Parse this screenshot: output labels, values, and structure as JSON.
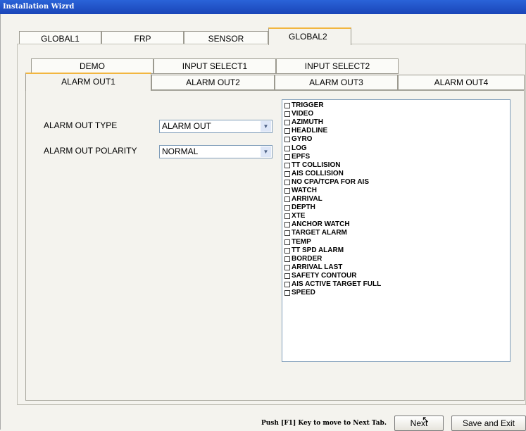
{
  "window": {
    "title": "Installation Wizrd"
  },
  "top_tabs": [
    {
      "label": "GLOBAL1",
      "active": false
    },
    {
      "label": "FRP",
      "active": false
    },
    {
      "label": "SENSOR",
      "active": false
    },
    {
      "label": "GLOBAL2",
      "active": true
    }
  ],
  "sub_tabs_row1": [
    {
      "label": "DEMO"
    },
    {
      "label": "INPUT SELECT1"
    },
    {
      "label": "INPUT SELECT2"
    }
  ],
  "sub_tabs_row2": [
    {
      "label": "ALARM OUT1",
      "active": true
    },
    {
      "label": "ALARM OUT2",
      "active": false
    },
    {
      "label": "ALARM OUT3",
      "active": false
    },
    {
      "label": "ALARM OUT4",
      "active": false
    }
  ],
  "form": {
    "type_label": "ALARM OUT TYPE",
    "type_value": "ALARM OUT",
    "polarity_label": "ALARM OUT POLARITY",
    "polarity_value": "NORMAL"
  },
  "alarm_items": [
    "TRIGGER",
    "VIDEO",
    "AZIMUTH",
    "HEADLINE",
    "GYRO",
    "LOG",
    "EPFS",
    "TT COLLISION",
    "AIS COLLISION",
    "NO CPA/TCPA FOR AIS",
    "WATCH",
    "ARRIVAL",
    "DEPTH",
    "XTE",
    "ANCHOR WATCH",
    "TARGET ALARM",
    "TEMP",
    "TT SPD ALARM",
    "BORDER",
    "ARRIVAL LAST",
    "SAFETY CONTOUR",
    "AIS ACTIVE TARGET FULL",
    "SPEED"
  ],
  "footer": {
    "hint": "Push [F1] Key to move to Next Tab.",
    "next_label": "Next",
    "save_exit_label": "Save and Exit"
  }
}
